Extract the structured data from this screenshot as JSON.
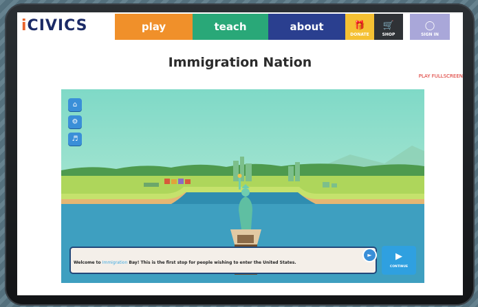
{
  "nav": {
    "logo": "iCIVICS",
    "play": "play",
    "teach": "teach",
    "about": "about",
    "donate": "DONATE",
    "shop": "SHOP",
    "sign_in": "SIGN IN"
  },
  "page": {
    "title": "Immigration Nation",
    "fullscreen": "PLAY FULLSCREEN"
  },
  "game": {
    "buttons": [
      "home-icon",
      "gear-icon",
      "speaker-icon"
    ],
    "dialog": {
      "prefix": "Welcome to ",
      "highlight": "Immigration",
      "suffix": " Bay! This is the first stop for people wishing to enter the United States."
    },
    "continue_label": "CONTINUE"
  },
  "colors": {
    "play": "#f0902a",
    "teach": "#29a878",
    "about": "#2a3f8f",
    "donate": "#f5c133",
    "shop": "#2f3236",
    "sign_in": "#a9a7d9",
    "fullscreen_text": "#d9231d",
    "water": "#3e9fc0"
  }
}
